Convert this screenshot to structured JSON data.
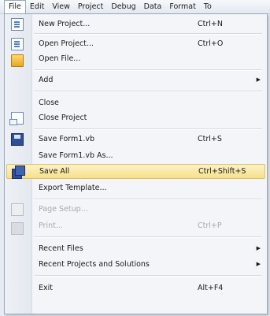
{
  "menubar": {
    "items": [
      "File",
      "Edit",
      "View",
      "Project",
      "Debug",
      "Data",
      "Format",
      "To"
    ]
  },
  "menu": {
    "new_project": {
      "label": "New Project...",
      "shortcut": "Ctrl+N",
      "icon": "new-project-icon"
    },
    "open_project": {
      "label": "Open Project...",
      "shortcut": "Ctrl+O",
      "icon": "open-project-icon"
    },
    "open_file": {
      "label": "Open File...",
      "icon": "folder-icon"
    },
    "add": {
      "label": "Add"
    },
    "close": {
      "label": "Close"
    },
    "close_project": {
      "label": "Close Project",
      "icon": "close-project-icon"
    },
    "save_form": {
      "label": "Save Form1.vb",
      "shortcut": "Ctrl+S",
      "icon": "save-icon"
    },
    "save_form_as": {
      "label": "Save Form1.vb As..."
    },
    "save_all": {
      "label": "Save All",
      "shortcut": "Ctrl+Shift+S",
      "icon": "save-all-icon"
    },
    "export_template": {
      "label": "Export Template..."
    },
    "page_setup": {
      "label": "Page Setup...",
      "icon": "page-setup-icon"
    },
    "print": {
      "label": "Print...",
      "shortcut": "Ctrl+P",
      "icon": "print-icon"
    },
    "recent_files": {
      "label": "Recent Files"
    },
    "recent_projects": {
      "label": "Recent Projects and Solutions"
    },
    "exit": {
      "label": "Exit",
      "shortcut": "Alt+F4"
    }
  },
  "colors": {
    "highlight": "#f6e08c",
    "disabled_text": "#a5a9b0"
  }
}
